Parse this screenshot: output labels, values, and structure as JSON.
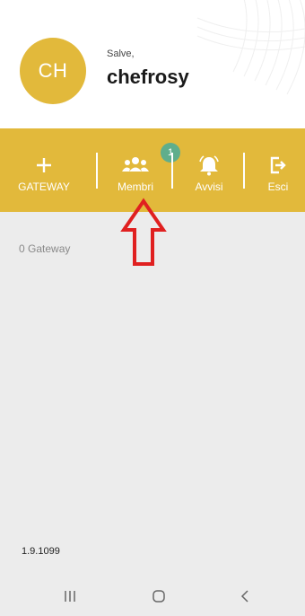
{
  "header": {
    "greeting": "Salve,",
    "username": "chefrosy",
    "avatar_initials": "CH",
    "accent_color": "#e2b93b"
  },
  "toolbar": {
    "items": [
      {
        "id": "gateway",
        "label": "GATEWAY",
        "icon": "plus-icon"
      },
      {
        "id": "membri",
        "label": "Membri",
        "icon": "group-icon",
        "badge": "1"
      },
      {
        "id": "avvisi",
        "label": "Avvisi",
        "icon": "bell-icon"
      },
      {
        "id": "esci",
        "label": "Esci",
        "icon": "logout-icon"
      }
    ],
    "badge_color": "#5fae8c"
  },
  "content": {
    "gateway_count": "0  Gateway",
    "version": "1.9.1099"
  },
  "annotation": {
    "icon": "red-up-arrow-icon",
    "color": "#e02020"
  },
  "navbar": {
    "items": [
      "recent-apps-icon",
      "home-icon",
      "back-icon"
    ]
  }
}
